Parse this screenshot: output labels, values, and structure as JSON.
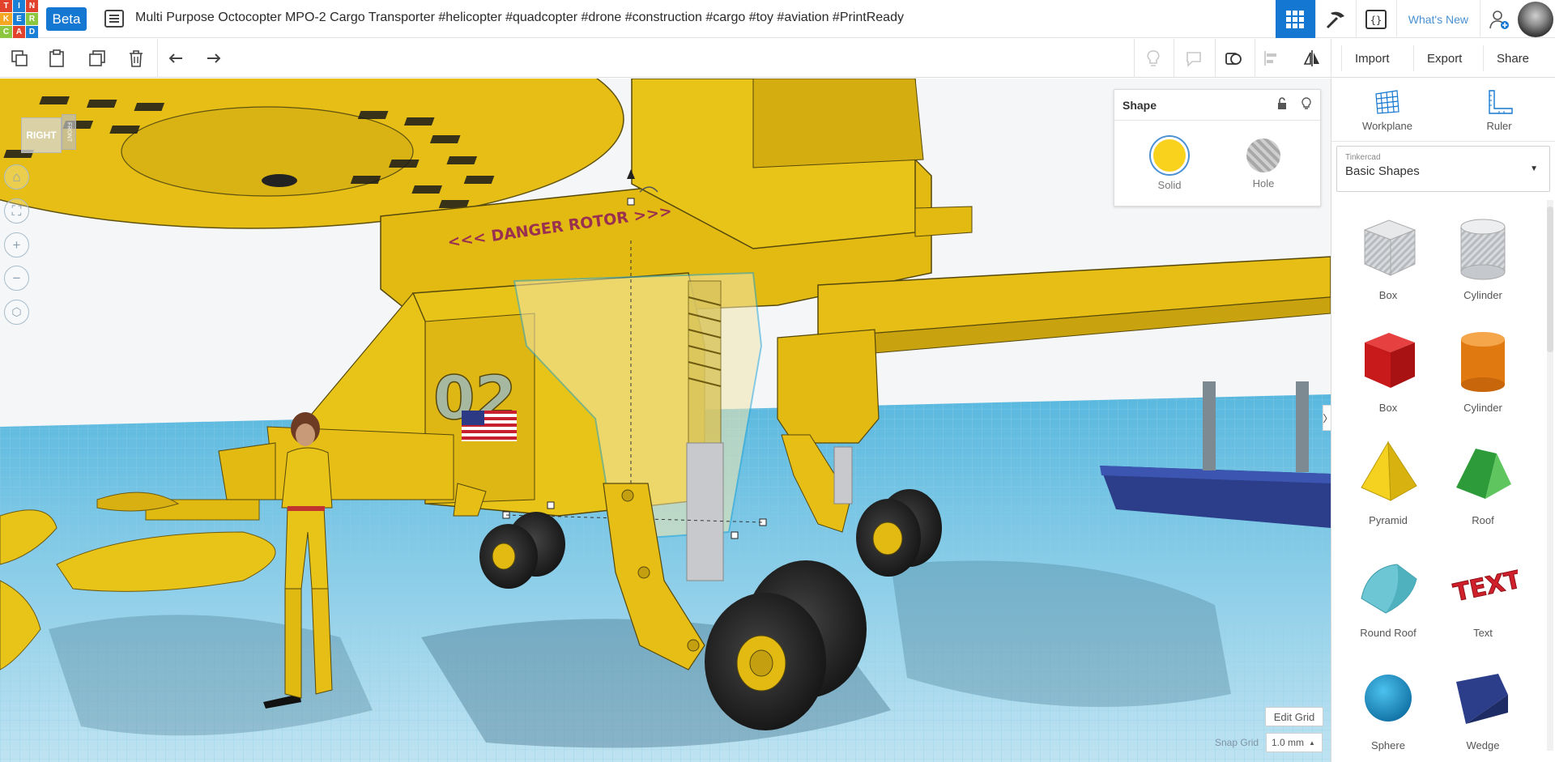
{
  "app": {
    "logo_letters": [
      "T",
      "I",
      "N",
      "K",
      "E",
      "R",
      "C",
      "A",
      "D"
    ],
    "logo_colors": [
      "#e2412b",
      "#1a7fd6",
      "#e2412b",
      "#f5a623",
      "#1a7fd6",
      "#8dc63f",
      "#8dc63f",
      "#e2412b",
      "#1a7fd6"
    ],
    "beta_label": "Beta",
    "title": "Multi Purpose Octocopter MPO-2 Cargo Transporter #helicopter #quadcopter #drone #construction #cargo #toy #aviation #PrintReady",
    "whats_new": "What's New"
  },
  "toolbar": {
    "import_label": "Import",
    "export_label": "Export",
    "share_label": "Share"
  },
  "viewport": {
    "viewcube_face": "RIGHT",
    "viewcube_side": "FRONT",
    "edit_grid_label": "Edit Grid",
    "snap_grid_label": "Snap Grid",
    "snap_grid_value": "1.0 mm"
  },
  "inspector": {
    "title": "Shape",
    "solid_label": "Solid",
    "hole_label": "Hole",
    "solid_color": "#f9d21e"
  },
  "scene": {
    "body_number": "02",
    "nose_text": "<<< DANGER ROTOR >>>"
  },
  "panel": {
    "workplane_label": "Workplane",
    "ruler_label": "Ruler",
    "library_source": "Tinkercad",
    "library_name": "Basic Shapes",
    "shapes": [
      {
        "label": "Box"
      },
      {
        "label": "Cylinder"
      },
      {
        "label": "Box"
      },
      {
        "label": "Cylinder"
      },
      {
        "label": "Pyramid"
      },
      {
        "label": "Roof"
      },
      {
        "label": "Round Roof"
      },
      {
        "label": "Text"
      },
      {
        "label": "Sphere"
      },
      {
        "label": "Wedge"
      }
    ]
  },
  "colors": {
    "accent": "#1477d1",
    "model_yellow": "#e9c418",
    "grid_blue": "#8fcfe8"
  }
}
